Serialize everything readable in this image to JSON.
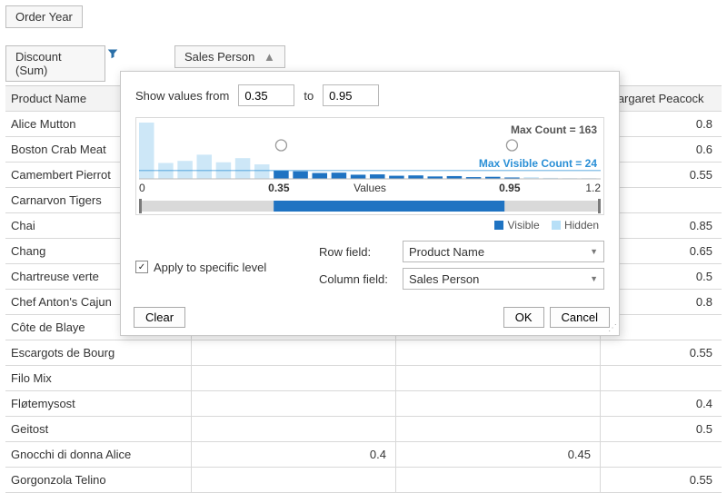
{
  "header": {
    "order_year": "Order Year",
    "discount_sum": "Discount (Sum)",
    "sales_person": "Sales Person"
  },
  "grid": {
    "col_product": "Product Name",
    "col_right": "Margaret Peacock",
    "rows": [
      {
        "label": "Alice Mutton",
        "mid1": "",
        "mid2": "",
        "right": "0.8"
      },
      {
        "label": "Boston Crab Meat",
        "mid1": "",
        "mid2": "",
        "right": "0.6"
      },
      {
        "label": "Camembert Pierrot",
        "mid1": "",
        "mid2": "",
        "right": "0.55"
      },
      {
        "label": "Carnarvon Tigers",
        "mid1": "",
        "mid2": "",
        "right": ""
      },
      {
        "label": "Chai",
        "mid1": "",
        "mid2": "",
        "right": "0.85"
      },
      {
        "label": "Chang",
        "mid1": "",
        "mid2": "",
        "right": "0.65"
      },
      {
        "label": "Chartreuse verte",
        "mid1": "",
        "mid2": "",
        "right": "0.5"
      },
      {
        "label": "Chef Anton's Cajun",
        "mid1": "",
        "mid2": "",
        "right": "0.8"
      },
      {
        "label": "Côte de Blaye",
        "mid1": "",
        "mid2": "",
        "right": ""
      },
      {
        "label": "Escargots de Bourg",
        "mid1": "",
        "mid2": "",
        "right": "0.55"
      },
      {
        "label": "Filo Mix",
        "mid1": "",
        "mid2": "",
        "right": ""
      },
      {
        "label": "Fløtemysost",
        "mid1": "",
        "mid2": "",
        "right": "0.4"
      },
      {
        "label": "Geitost",
        "mid1": "",
        "mid2": "",
        "right": "0.5"
      },
      {
        "label": "Gnocchi di donna Alice",
        "mid1": "0.4",
        "mid2": "0.45",
        "right": ""
      },
      {
        "label": "Gorgonzola Telino",
        "mid1": "",
        "mid2": "",
        "right": "0.55"
      }
    ]
  },
  "popup": {
    "show_values_from": "Show values from",
    "from_value": "0.35",
    "to_label": "to",
    "to_value": "0.95",
    "max_count_label": "Max Count = 163",
    "max_visible_label": "Max Visible Count = 24",
    "tick0": "0",
    "tick_from": "0.35",
    "axis_label": "Values",
    "tick_to": "0.95",
    "tick_max": "1.2",
    "legend_visible": "Visible",
    "legend_hidden": "Hidden",
    "apply_specific": "Apply to specific level",
    "row_field_label": "Row field:",
    "row_field_value": "Product Name",
    "col_field_label": "Column field:",
    "col_field_value": "Sales Person",
    "btn_clear": "Clear",
    "btn_ok": "OK",
    "btn_cancel": "Cancel"
  },
  "chart_data": {
    "type": "bar",
    "title": "",
    "xlabel": "Values",
    "ylabel": "",
    "xlim": [
      0,
      1.2
    ],
    "selection": [
      0.35,
      0.95
    ],
    "max_count": 163,
    "max_visible_count": 24,
    "legend": [
      "Visible",
      "Hidden"
    ],
    "bins": [
      {
        "x": 0.0,
        "count": 163,
        "state": "hidden"
      },
      {
        "x": 0.05,
        "count": 46,
        "state": "hidden"
      },
      {
        "x": 0.1,
        "count": 52,
        "state": "hidden"
      },
      {
        "x": 0.15,
        "count": 70,
        "state": "hidden"
      },
      {
        "x": 0.2,
        "count": 48,
        "state": "hidden"
      },
      {
        "x": 0.25,
        "count": 60,
        "state": "hidden"
      },
      {
        "x": 0.3,
        "count": 42,
        "state": "hidden"
      },
      {
        "x": 0.35,
        "count": 24,
        "state": "visible"
      },
      {
        "x": 0.4,
        "count": 22,
        "state": "visible"
      },
      {
        "x": 0.45,
        "count": 17,
        "state": "visible"
      },
      {
        "x": 0.5,
        "count": 18,
        "state": "visible"
      },
      {
        "x": 0.55,
        "count": 12,
        "state": "visible"
      },
      {
        "x": 0.6,
        "count": 13,
        "state": "visible"
      },
      {
        "x": 0.65,
        "count": 9,
        "state": "visible"
      },
      {
        "x": 0.7,
        "count": 10,
        "state": "visible"
      },
      {
        "x": 0.75,
        "count": 7,
        "state": "visible"
      },
      {
        "x": 0.8,
        "count": 8,
        "state": "visible"
      },
      {
        "x": 0.85,
        "count": 5,
        "state": "visible"
      },
      {
        "x": 0.9,
        "count": 6,
        "state": "visible"
      },
      {
        "x": 0.95,
        "count": 4,
        "state": "visible"
      },
      {
        "x": 1.0,
        "count": 5,
        "state": "hidden"
      },
      {
        "x": 1.05,
        "count": 3,
        "state": "hidden"
      },
      {
        "x": 1.1,
        "count": 2,
        "state": "hidden"
      },
      {
        "x": 1.15,
        "count": 2,
        "state": "hidden"
      }
    ]
  }
}
